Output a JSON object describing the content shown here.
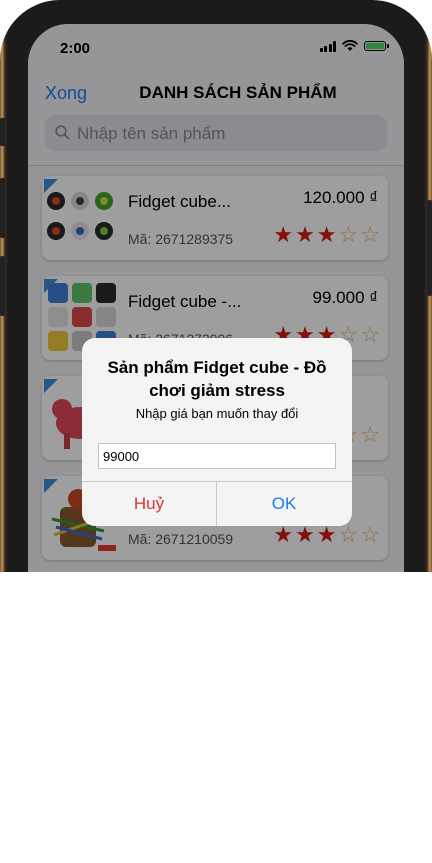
{
  "status_bar": {
    "time": "2:00"
  },
  "nav": {
    "done_label": "Xong",
    "title": "DANH SÁCH SẢN PHẨM"
  },
  "search": {
    "placeholder": "Nhập tên sản phẩm",
    "value": ""
  },
  "products": [
    {
      "name": "Fidget cube...",
      "price": "120.000 ₫",
      "code": "Mã: 2671289375",
      "rating": 3,
      "max_rating": 5
    },
    {
      "name": "Fidget cube -...",
      "price": "99.000 ₫",
      "code": "Mã: 2671273906",
      "rating": 3,
      "max_rating": 5
    },
    {
      "name": "",
      "price": "",
      "code": "",
      "rating": 3,
      "max_rating": 5
    },
    {
      "name": "",
      "price": "",
      "code": "Mã: 2671210059",
      "rating": 3,
      "max_rating": 5
    }
  ],
  "dialog": {
    "title": "Sản phẩm Fidget cube - Đồ chơi giảm stress",
    "message": "Nhập giá bạn muốn thay đổi",
    "input_value": "99000",
    "cancel_label": "Huỷ",
    "ok_label": "OK"
  },
  "colors": {
    "accent": "#1e7cf2",
    "star_filled": "#d21a12",
    "star_empty": "#e3b06a",
    "cancel": "#e0342c"
  }
}
